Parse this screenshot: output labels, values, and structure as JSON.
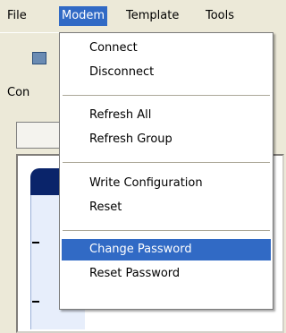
{
  "menubar": {
    "items": [
      {
        "label": "File"
      },
      {
        "label": "Modem"
      },
      {
        "label": "Template"
      },
      {
        "label": "Tools"
      }
    ]
  },
  "toolbar": {
    "connect_label": "Con"
  },
  "dropdown": {
    "items": [
      {
        "label": "Connect"
      },
      {
        "label": "Disconnect"
      },
      {
        "label": "Refresh All"
      },
      {
        "label": "Refresh Group"
      },
      {
        "label": "Write Configuration"
      },
      {
        "label": "Reset"
      },
      {
        "label": "Change Password"
      },
      {
        "label": "Reset Password"
      }
    ]
  },
  "background": {
    "dash_1": "-",
    "dash_2": "-"
  },
  "colors": {
    "highlight": "#316ac5",
    "menubar_bg": "#ece9d8",
    "header_dark": "#0a246a"
  }
}
